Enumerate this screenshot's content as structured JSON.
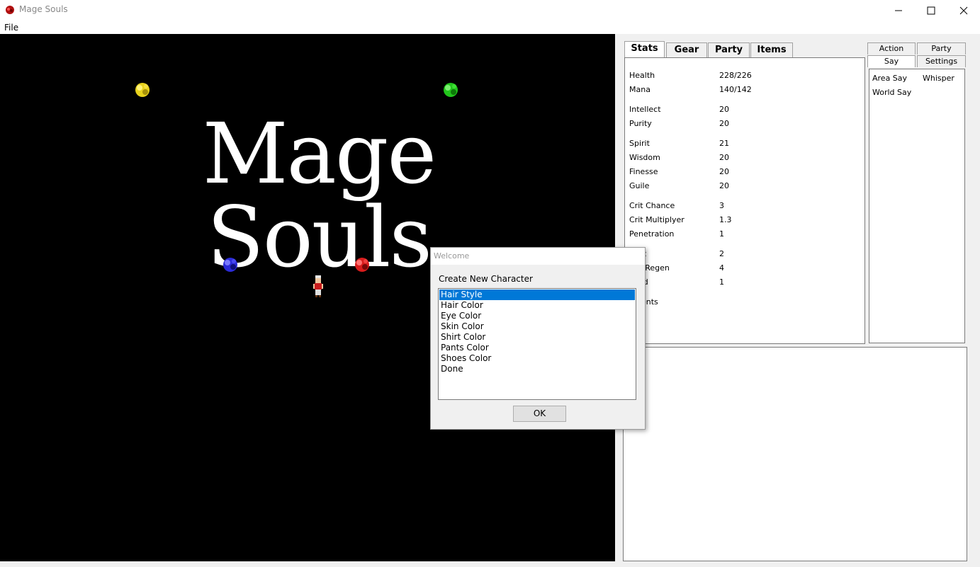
{
  "window": {
    "title": "Mage Souls"
  },
  "menu": {
    "file": "File"
  },
  "game": {
    "logo_text": "Mage Souls"
  },
  "main_tabs": [
    "Stats",
    "Gear",
    "Party",
    "Items"
  ],
  "stats": [
    {
      "label": "Health",
      "value": "228/226"
    },
    {
      "label": "Mana",
      "value": "140/142"
    },
    {
      "label": "Intellect",
      "value": "20"
    },
    {
      "label": "Purity",
      "value": "20"
    },
    {
      "label": "Spirit",
      "value": "21"
    },
    {
      "label": "Wisdom",
      "value": "20"
    },
    {
      "label": "Finesse",
      "value": "20"
    },
    {
      "label": "Guile",
      "value": "20"
    },
    {
      "label": "Crit Chance",
      "value": "3"
    },
    {
      "label": "Crit Multiplyer",
      "value": "1.3"
    },
    {
      "label": "Penetration",
      "value": "1"
    },
    {
      "label": "st",
      "value": "2"
    },
    {
      "label": "a Regen",
      "value": "4"
    },
    {
      "label": "ed",
      "value": "1"
    },
    {
      "label": "ents",
      "value": ""
    }
  ],
  "chat_tabs": {
    "action": "Action",
    "party": "Party",
    "say": "Say",
    "settings": "Settings"
  },
  "chat_options": {
    "area_say": "Area Say",
    "whisper": "Whisper",
    "world_say": "World Say"
  },
  "dialog": {
    "title": "Welcome",
    "label": "Create New Character",
    "options": [
      "Hair Style",
      "Hair Color",
      "Eye Color",
      "Skin Color",
      "Shirt Color",
      "Pants Color",
      "Shoes Color",
      "Done"
    ],
    "selected": "Hair Style",
    "ok": "OK"
  },
  "colors": {
    "orb_yellow": "#e8d21c",
    "orb_green": "#22c51c",
    "orb_blue": "#2b2bd8",
    "orb_red": "#d81c1c",
    "selection": "#0078d7"
  }
}
